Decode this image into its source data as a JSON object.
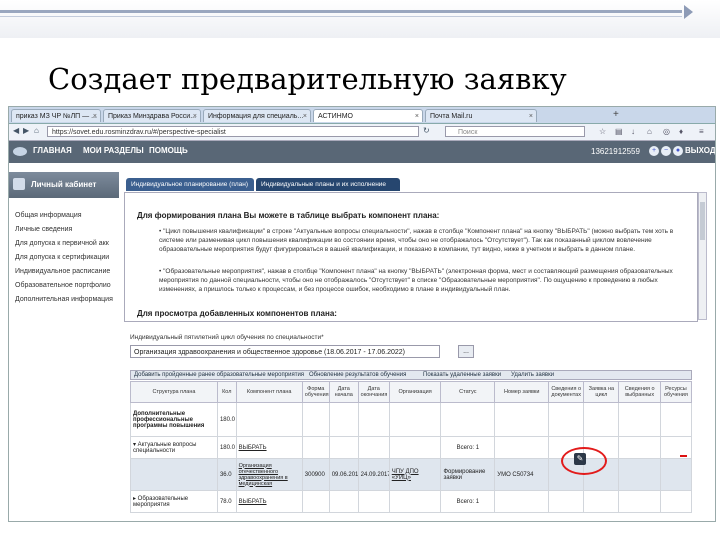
{
  "slide": {
    "title": "Создает предварительную заявку"
  },
  "browser": {
    "tabs": [
      {
        "label": "приказ МЗ ЧР №ЛП — ..."
      },
      {
        "label": "Приказ Минздрава Росси..."
      },
      {
        "label": "Информация для специаль..."
      },
      {
        "label": "АСТИНМО"
      },
      {
        "label": "Почта Mail.ru"
      }
    ],
    "url": "https://sovet.edu.rosminzdrav.ru/#/perspective-specialist",
    "search_placeholder": "Поиск"
  },
  "menu": {
    "items": [
      "ГЛАВНАЯ",
      "МОИ РАЗДЕЛЫ",
      "ПОМОЩЬ"
    ],
    "phone": "13621912559",
    "exit": "ВЫХОД"
  },
  "sidebar": {
    "header": "Личный кабинет",
    "items": [
      "Общая информация",
      "Личные сведения",
      "Для допуска к первичной акк",
      "Для допуска к сертификации",
      "Индивидуальное расписание",
      "Образовательное портфолио",
      "Дополнительная информация"
    ]
  },
  "content": {
    "tabs": [
      "Индивидуальное планирование (план)",
      "Индивидуальные планы и их исполнение"
    ],
    "panel_heading": "Для формирования плана Вы можете в таблице выбрать компонент плана:",
    "bullet1": "• \"Цикл повышения квалификации\" в строке \"Актуальные вопросы специальности\", нажав в столбце \"Компонент плана\" на кнопку \"ВЫБРАТЬ\" (можно выбрать тем хоть в системе или разменивая цикл повышения квалификации во состоянии время, чтобы оно не отображалось \"Отсутствует\"). Так как показанный циклом вовлечение образовательные мероприятия будут фигурироваться в вашей квалификации, и показано в компании, тут видно, ниже в учетном и выбрать в данном плане.",
    "bullet2": "• \"Образовательные мероприятия\", нажав в столбце \"Компонент плана\" на кнопку \"ВЫБРАТЬ\" (электронная форма, мест и составляющий размещения образовательных мероприятия по данной специальности, чтобы оно не отображалось \"Отсутствует\" в списке \"Образовательные мероприятия\". По ощущению к проведению в любых изменениях, а пришлось только к процессам, и без процессе ошибок, необходимо в плане в индивидуальный план.",
    "panel_heading2": "Для просмотра добавленных компонентов плана:",
    "filter_label": "Индивидуальный пятилетний цикл обучения по специальности*",
    "filter_value": "Организация здравоохранения и общественное здоровье (18.06.2017 - 17.06.2022)",
    "dots": "...",
    "toolbar": [
      "Добавить пройденные ранее образовательные мероприятия",
      "Обновление результатов обучения",
      "Показать удаленные заявки",
      "Удалить заявки"
    ]
  },
  "table": {
    "headers": [
      "Структура плана",
      "Кол",
      "Компонент плана",
      "Форма обучения",
      "Дата начала",
      "Дата окончания",
      "Организация",
      "Статус",
      "Номер заявки",
      "Сведения о документах",
      "Заявка на цикл",
      "Сведения о выбранных",
      "Ресурсы обучения"
    ],
    "rows": [
      [
        "Дополнительные профессиональные программы повышения",
        "180.0",
        "",
        "",
        "",
        "",
        "",
        "",
        "",
        "",
        "",
        "",
        ""
      ],
      [
        "▾ Актуальные вопросы специальности",
        "180.0",
        "ВЫБРАТЬ",
        "",
        "",
        "",
        "",
        "Всего: 1",
        "",
        "",
        "",
        "",
        ""
      ],
      [
        "",
        "36.0",
        "Организация отечественного здравоохранения в медицинская",
        "300900",
        "09.06.2017",
        "24.09.2017",
        "ЧПУ ДПО «УИЦ»",
        "Формирование заявки",
        "УМО С50734",
        "",
        "",
        "",
        ""
      ],
      [
        "▸ Образовательные мероприятия",
        "78.0",
        "ВЫБРАТЬ",
        "",
        "",
        "",
        "",
        "Всего: 1",
        "",
        "",
        "",
        "",
        ""
      ]
    ]
  },
  "colors": {
    "accent": "#26466f",
    "menubar": "#596776",
    "highlight": "#e21b1b"
  }
}
